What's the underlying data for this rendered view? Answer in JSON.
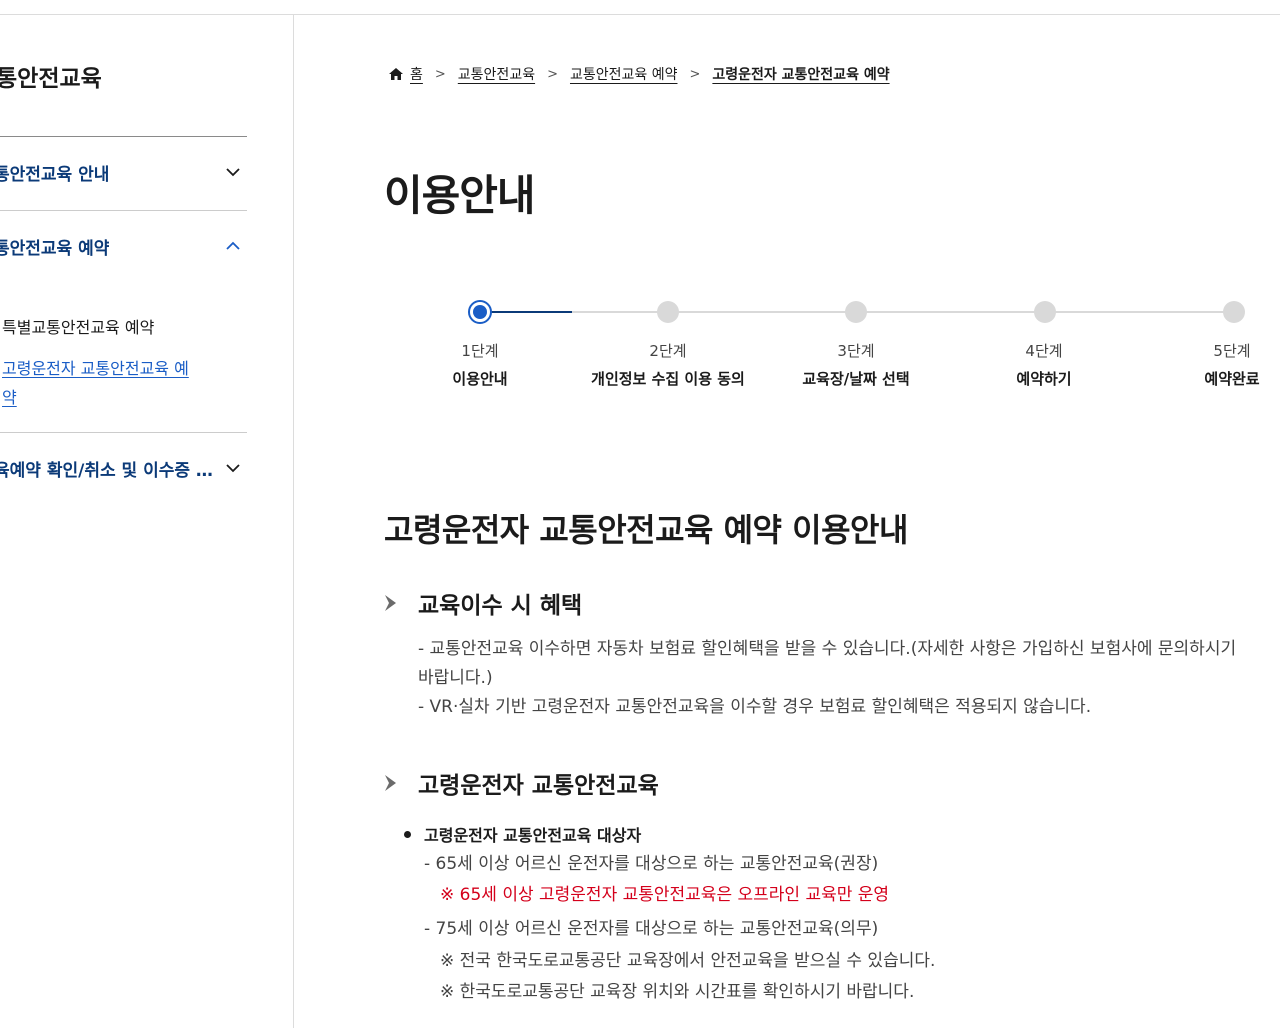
{
  "sidebar": {
    "title": "통안전교육",
    "items": [
      {
        "label": "통안전교육 안내",
        "icon": "chevron-down-icon"
      },
      {
        "label": "통안전교육 예약",
        "icon": "chevron-up-icon"
      },
      {
        "label": "육예약 확인/취소 및 이수증 …",
        "icon": "chevron-down-icon"
      }
    ],
    "sub_items": [
      {
        "label": "특별교통안전교육 예약"
      },
      {
        "label": "고령운전자 교통안전교육 예약"
      }
    ]
  },
  "breadcrumb": {
    "home": "홈",
    "items": [
      "교통안전교육",
      "교통안전교육 예약",
      "고령운전자 교통안전교육 예약"
    ],
    "separator": ">"
  },
  "page_title": "이용안내",
  "stepper": {
    "current_step": 1,
    "steps": [
      {
        "num": "1단계",
        "label": "이용안내"
      },
      {
        "num": "2단계",
        "label": "개인정보 수집 이용 동의"
      },
      {
        "num": "3단계",
        "label": "교육장/날짜 선택"
      },
      {
        "num": "4단계",
        "label": "예약하기"
      },
      {
        "num": "5단계",
        "label": "예약완료"
      }
    ]
  },
  "content": {
    "section_title": "고령운전자 교통안전교육 예약 이용안내",
    "benefits": {
      "heading": "교육이수 시 혜택",
      "line1": "- 교통안전교육 이수하면 자동차 보험료 할인혜택을 받을 수 있습니다.(자세한 사항은 가입하신 보험사에 문의하시기",
      "line2": "바랍니다.)",
      "line3": "- VR·실차 기반 고령운전자 교통안전교육을 이수할 경우 보험료 할인혜택은 적용되지 않습니다."
    },
    "elderly": {
      "heading": "고령운전자 교통안전교육",
      "target_heading": "고령운전자 교통안전교육 대상자",
      "line1": "- 65세 이상 어르신 운전자를 대상으로 하는 교통안전교육(권장)",
      "note_red": "※ 65세 이상 고령운전자 교통안전교육은 오프라인 교육만 운영",
      "line2": "- 75세 이상 어르신 운전자를 대상으로 하는 교통안전교육(의무)",
      "note1": "※ 전국 한국도로교통공단 교육장에서 안전교육을 받으실 수 있습니다.",
      "note2": "※ 한국도로교통공단 교육장 위치와 시간표를 확인하시기 바랍니다."
    }
  },
  "colors": {
    "brand_navy": "#0b3a78",
    "link_blue": "#1a5dc6",
    "notice_red": "#d4001b"
  }
}
